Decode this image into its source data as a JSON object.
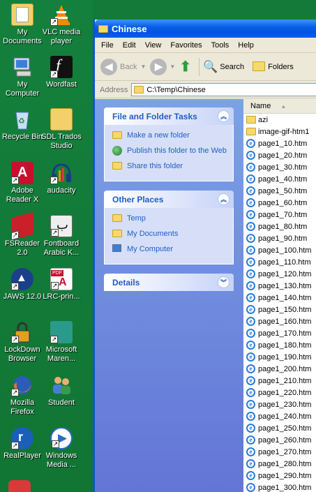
{
  "desktop": {
    "icons": [
      {
        "label": "My Documents",
        "icon": "my-documents-icon"
      },
      {
        "label": "VLC media player",
        "icon": "vlc-icon"
      },
      {
        "label": "My Computer",
        "icon": "my-computer-icon"
      },
      {
        "label": "Wordfast",
        "icon": "wordfast-icon"
      },
      {
        "label": "Recycle Bin",
        "icon": "recycle-bin-icon"
      },
      {
        "label": "SDL Trados Studio",
        "icon": "sdl-trados-icon"
      },
      {
        "label": "Adobe Reader X",
        "icon": "adobe-reader-icon"
      },
      {
        "label": "audacity",
        "icon": "audacity-icon"
      },
      {
        "label": "FSReader 2.0",
        "icon": "fsreader-icon"
      },
      {
        "label": "Fontboard Arabic K...",
        "icon": "fontboard-icon"
      },
      {
        "label": "JAWS 12.0",
        "icon": "jaws-icon"
      },
      {
        "label": "LRC-prin...",
        "icon": "pdf-file-icon"
      },
      {
        "label": "LockDown Browser",
        "icon": "lockdown-browser-icon"
      },
      {
        "label": "Microsoft Maren...",
        "icon": "microsoft-app-icon"
      },
      {
        "label": "Mozilla Firefox",
        "icon": "firefox-icon"
      },
      {
        "label": "Student",
        "icon": "users-icon"
      },
      {
        "label": "RealPlayer",
        "icon": "realplayer-icon"
      },
      {
        "label": "Windows Media ...",
        "icon": "windows-media-icon"
      }
    ]
  },
  "window": {
    "title": "Chinese",
    "menu": [
      "File",
      "Edit",
      "View",
      "Favorites",
      "Tools",
      "Help"
    ],
    "toolbar": {
      "back_label": "Back",
      "search_label": "Search",
      "folders_label": "Folders"
    },
    "address": {
      "label": "Address",
      "value": "C:\\Temp\\Chinese"
    },
    "taskpane": {
      "file_folder_tasks": {
        "title": "File and Folder Tasks",
        "items": [
          "Make a new folder",
          "Publish this folder to the Web",
          "Share this folder"
        ]
      },
      "other_places": {
        "title": "Other Places",
        "items": [
          "Temp",
          "My Documents",
          "My Computer"
        ]
      },
      "details": {
        "title": "Details"
      }
    },
    "filelist": {
      "column_name": "Name",
      "files": [
        {
          "name": "azi",
          "type": "folder"
        },
        {
          "name": "image-gif-htm1",
          "type": "folder"
        },
        {
          "name": "page1_10.htm",
          "type": "htm"
        },
        {
          "name": "page1_20.htm",
          "type": "htm"
        },
        {
          "name": "page1_30.htm",
          "type": "htm"
        },
        {
          "name": "page1_40.htm",
          "type": "htm"
        },
        {
          "name": "page1_50.htm",
          "type": "htm"
        },
        {
          "name": "page1_60.htm",
          "type": "htm"
        },
        {
          "name": "page1_70.htm",
          "type": "htm"
        },
        {
          "name": "page1_80.htm",
          "type": "htm"
        },
        {
          "name": "page1_90.htm",
          "type": "htm"
        },
        {
          "name": "page1_100.htm",
          "type": "htm"
        },
        {
          "name": "page1_110.htm",
          "type": "htm"
        },
        {
          "name": "page1_120.htm",
          "type": "htm"
        },
        {
          "name": "page1_130.htm",
          "type": "htm"
        },
        {
          "name": "page1_140.htm",
          "type": "htm"
        },
        {
          "name": "page1_150.htm",
          "type": "htm"
        },
        {
          "name": "page1_160.htm",
          "type": "htm"
        },
        {
          "name": "page1_170.htm",
          "type": "htm"
        },
        {
          "name": "page1_180.htm",
          "type": "htm"
        },
        {
          "name": "page1_190.htm",
          "type": "htm"
        },
        {
          "name": "page1_200.htm",
          "type": "htm"
        },
        {
          "name": "page1_210.htm",
          "type": "htm"
        },
        {
          "name": "page1_220.htm",
          "type": "htm"
        },
        {
          "name": "page1_230.htm",
          "type": "htm"
        },
        {
          "name": "page1_240.htm",
          "type": "htm"
        },
        {
          "name": "page1_250.htm",
          "type": "htm"
        },
        {
          "name": "page1_260.htm",
          "type": "htm"
        },
        {
          "name": "page1_270.htm",
          "type": "htm"
        },
        {
          "name": "page1_280.htm",
          "type": "htm"
        },
        {
          "name": "page1_290.htm",
          "type": "htm"
        },
        {
          "name": "page1_300.htm",
          "type": "htm"
        }
      ]
    }
  },
  "colors": {
    "desktop": "#137a3a",
    "title_bar": "#0053e1",
    "task_pane": "#6f8fe0",
    "link_blue": "#215dc6"
  }
}
